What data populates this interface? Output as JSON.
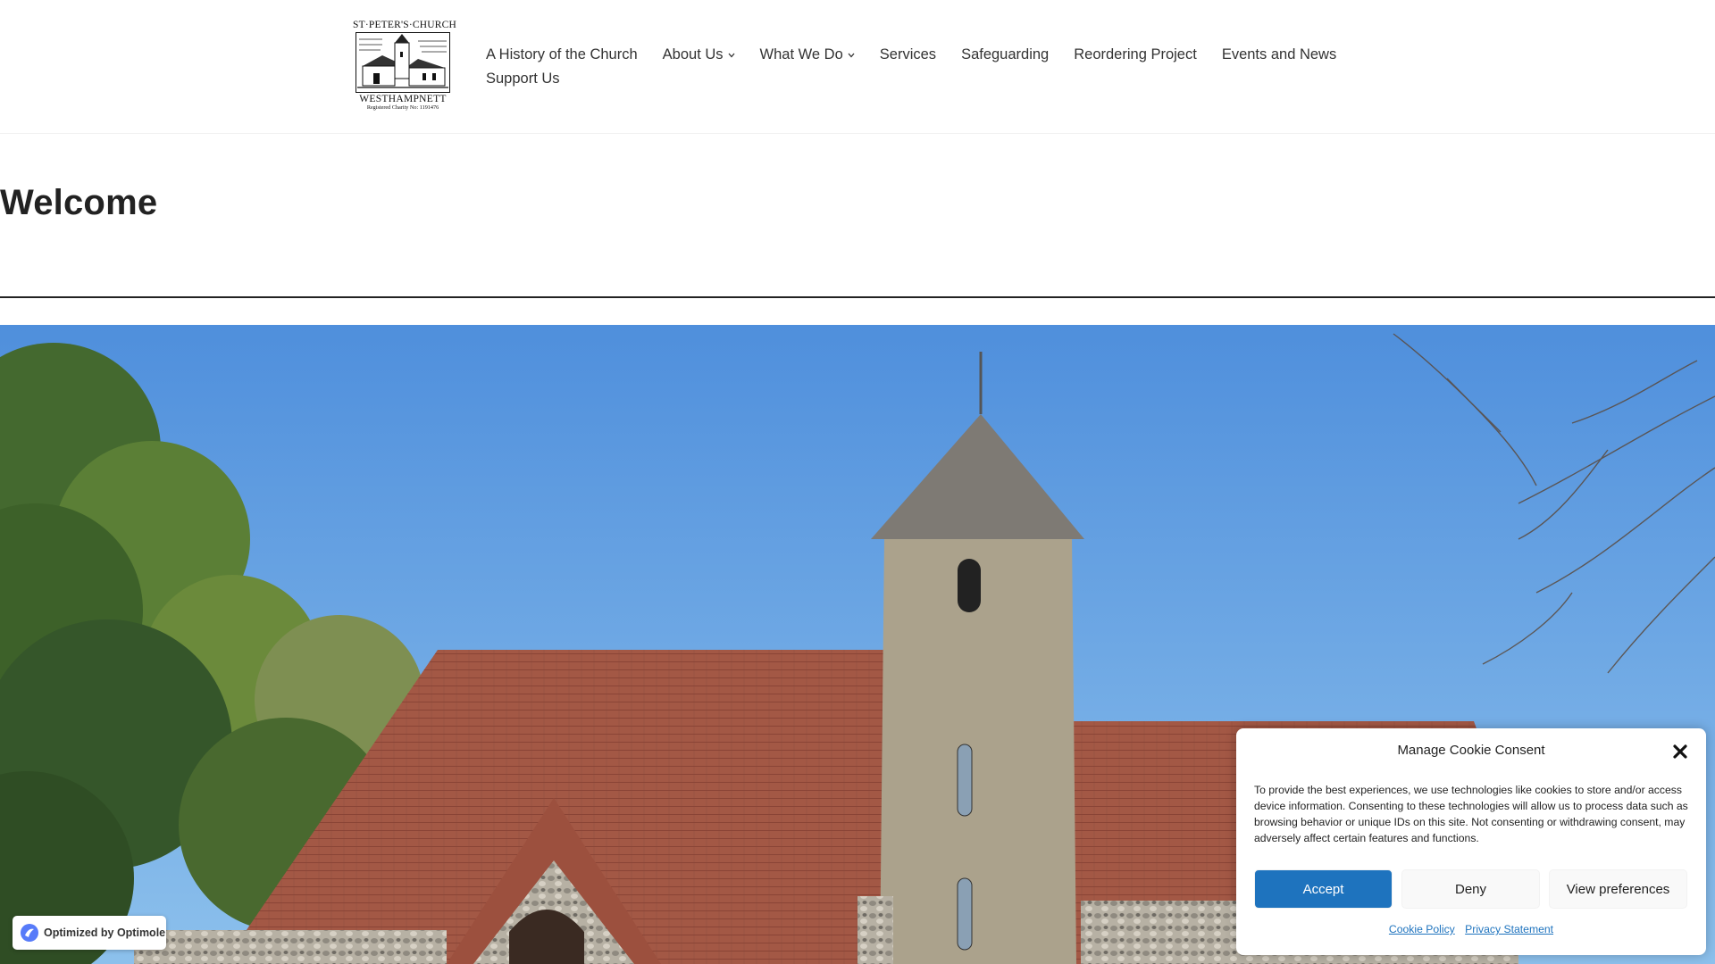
{
  "logo": {
    "top_text": "ST·PETER'S·CHURCH",
    "bottom_text": "WESTHAMPNETT",
    "charity_text": "Registered Charity No: 1191476"
  },
  "nav": {
    "items": [
      {
        "label": "A History of the Church",
        "has_dropdown": false
      },
      {
        "label": "About Us",
        "has_dropdown": true
      },
      {
        "label": "What We Do",
        "has_dropdown": true
      },
      {
        "label": "Services",
        "has_dropdown": false
      },
      {
        "label": "Safeguarding",
        "has_dropdown": false
      },
      {
        "label": "Reordering Project",
        "has_dropdown": false
      },
      {
        "label": "Events and News",
        "has_dropdown": false
      },
      {
        "label": "Support Us",
        "has_dropdown": false
      }
    ]
  },
  "page": {
    "title": "Welcome"
  },
  "optimole": {
    "label": "Optimized by Optimole"
  },
  "cookie": {
    "title": "Manage Cookie Consent",
    "text": "To provide the best experiences, we use technologies like cookies to store and/or access device information. Consenting to these technologies will allow us to process data such as browsing behavior or unique IDs on this site. Not consenting or withdrawing consent, may adversely affect certain features and functions.",
    "accept_label": "Accept",
    "deny_label": "Deny",
    "preferences_label": "View preferences",
    "cookie_policy_link": "Cookie Policy",
    "privacy_link": "Privacy Statement"
  },
  "colors": {
    "accent": "#1e73be",
    "text": "#222222",
    "sky": "#5c9be0",
    "roof": "#a85a48"
  }
}
